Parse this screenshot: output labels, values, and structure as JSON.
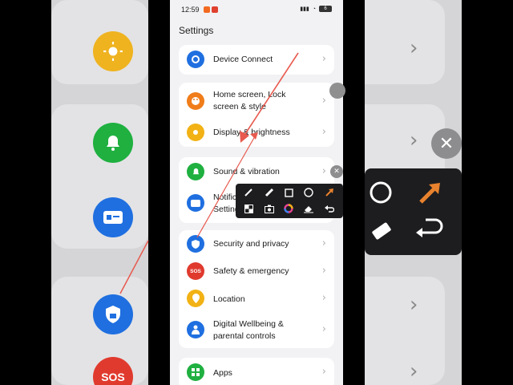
{
  "status_bar": {
    "time": "12:59",
    "battery": "6"
  },
  "page_title": "Settings",
  "groups": [
    {
      "items": [
        {
          "label": "Device Connect",
          "icon": "device-connect-icon",
          "color": "#1f6fe0"
        }
      ]
    },
    {
      "items": [
        {
          "label": "Home screen, Lock screen & style",
          "icon": "palette-icon",
          "color": "#f07d1a"
        },
        {
          "label": "Display & brightness",
          "icon": "sun-icon",
          "color": "#f2b215"
        }
      ]
    },
    {
      "items": [
        {
          "label": "Sound & vibration",
          "icon": "bell-icon",
          "color": "#1fb040"
        },
        {
          "label": "Notifications & Quick Settings",
          "icon": "notification-card-icon",
          "color": "#1f6fe0"
        }
      ]
    },
    {
      "items": [
        {
          "label": "Security and privacy",
          "icon": "shield-lock-icon",
          "color": "#1f6fe0"
        },
        {
          "label": "Safety & emergency",
          "icon": "sos-icon",
          "icon_text": "SOS",
          "color": "#e03a2e"
        },
        {
          "label": "Location",
          "icon": "location-pin-icon",
          "color": "#f2b215"
        },
        {
          "label": "Digital Wellbeing & parental controls",
          "icon": "person-icon",
          "color": "#1f6fe0"
        }
      ]
    },
    {
      "items": [
        {
          "label": "Apps",
          "icon": "apps-grid-icon",
          "color": "#1fb040"
        }
      ]
    }
  ],
  "background_zoom": {
    "sos_text": "SOS"
  },
  "annotation_tools": [
    "pen-icon",
    "highlighter-icon",
    "rectangle-icon",
    "circle-icon",
    "arrow-icon",
    "mosaic-icon",
    "camera-icon",
    "color-picker-icon",
    "eraser-icon",
    "undo-icon"
  ],
  "colors": {
    "accent_arrow": "#e85a4f",
    "toolbar_bg": "#1d1d1f",
    "screen_bg": "#f2f2f4"
  }
}
